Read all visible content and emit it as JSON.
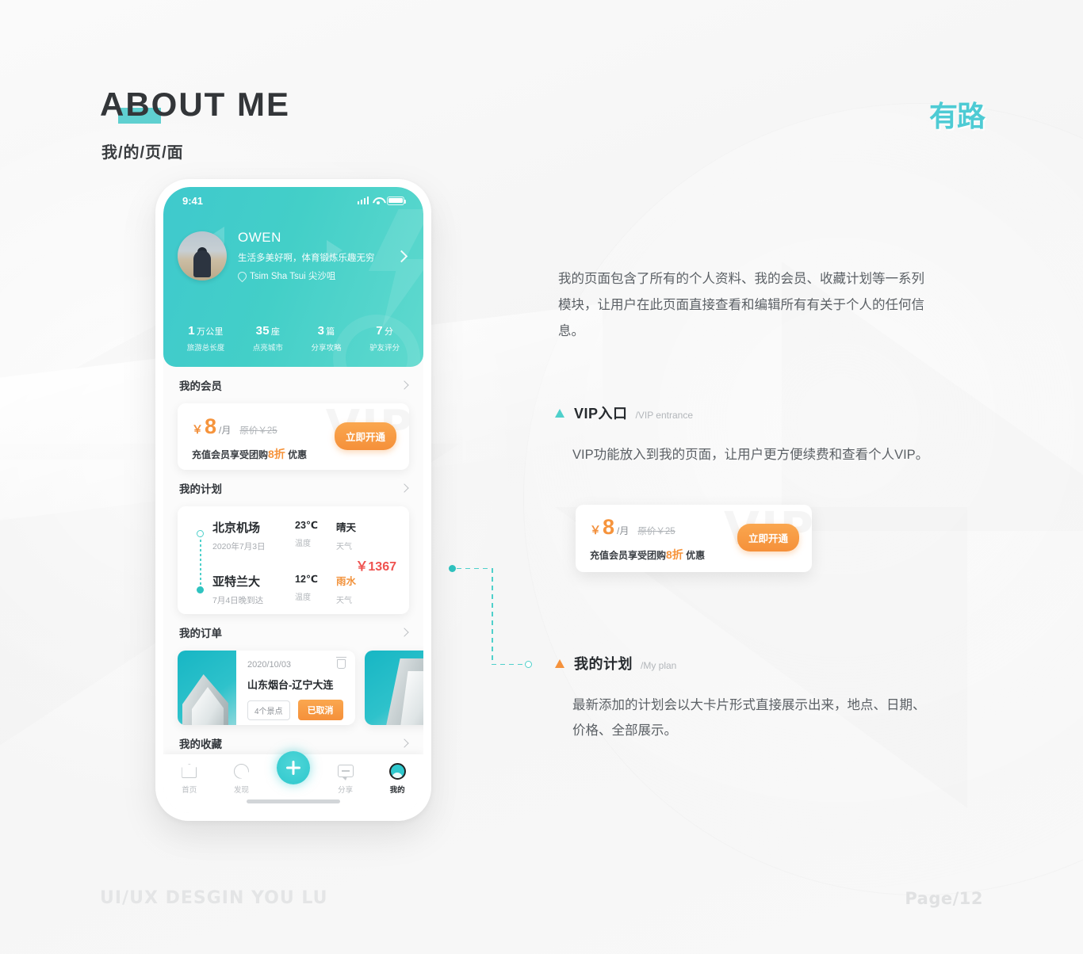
{
  "header": {
    "title": "ABOUT ME",
    "subtitle": "我/的/页/面",
    "brand": "有路"
  },
  "phone": {
    "status_bar": {
      "time": "9:41"
    },
    "profile": {
      "name": "OWEN",
      "bio": "生活多美好啊，体育锻炼乐趣无穷",
      "location": "Tsim Sha Tsui 尖沙咀"
    },
    "stats": [
      {
        "value": "1",
        "unit": "万公里",
        "label": "旅游总长度"
      },
      {
        "value": "35",
        "unit": "座",
        "label": "点亮城市"
      },
      {
        "value": "3",
        "unit": "篇",
        "label": "分享攻略"
      },
      {
        "value": "7",
        "unit": "分",
        "label": "驴友评分"
      }
    ],
    "sections": {
      "member": "我的会员",
      "plan": "我的计划",
      "order": "我的订单",
      "favorite": "我的收藏"
    },
    "vip_card": {
      "currency": "￥",
      "price": "8",
      "per": "/月",
      "original": "原价￥25",
      "subtitle_prefix": "充值会员享受团购",
      "discount": "8折",
      "subtitle_suffix": "优惠",
      "button": "立即开通",
      "ghost": "VIP"
    },
    "plan_card": {
      "price": "￥1367",
      "legs": [
        {
          "city": "北京机场",
          "date": "2020年7月3日",
          "temp": "23℃",
          "temp_label": "温度",
          "weather": "晴天",
          "weather_label": "天气"
        },
        {
          "city": "亚特兰大",
          "date": "7月4日晚到达",
          "temp": "12℃",
          "temp_label": "温度",
          "weather": "雨水",
          "weather_label": "天气"
        }
      ]
    },
    "order_card": {
      "date": "2020/10/03",
      "route": "山东烟台-辽宁大连",
      "spots": "4个景点",
      "status": "已取消"
    },
    "tabs": [
      {
        "label": "首页",
        "icon": "home-icon",
        "active": false
      },
      {
        "label": "发现",
        "icon": "search-icon",
        "active": false
      },
      {
        "label": "",
        "icon": "plus-icon",
        "active": false
      },
      {
        "label": "分享",
        "icon": "chat-icon",
        "active": false
      },
      {
        "label": "我的",
        "icon": "profile-icon",
        "active": true
      }
    ]
  },
  "intro": "我的页面包含了所有的个人资料、我的会员、收藏计划等一系列模块，让用户在此页面直接查看和编辑所有有关于个人的任何信息。",
  "notes": [
    {
      "title": "VIP入口",
      "en": "/VIP entrance",
      "body": "VIP功能放入到我的页面，让用户更方便续费和查看个人VIP。",
      "accent": "#4fd0cb"
    },
    {
      "title": "我的计划",
      "en": "/My plan",
      "body": "最新添加的计划会以大卡片形式直接展示出来，地点、日期、价格、全部展示。",
      "accent": "#f5923c"
    }
  ],
  "footer": {
    "left": "UI/UX DESGIN YOU LU",
    "right": "Page/12"
  },
  "colors": {
    "teal": "#3fc9cd",
    "teal_dark": "#2fc3c0",
    "orange": "#f5923c",
    "red": "#ef5350",
    "text_dark": "#262a2e",
    "text_gray": "#5b6065"
  }
}
